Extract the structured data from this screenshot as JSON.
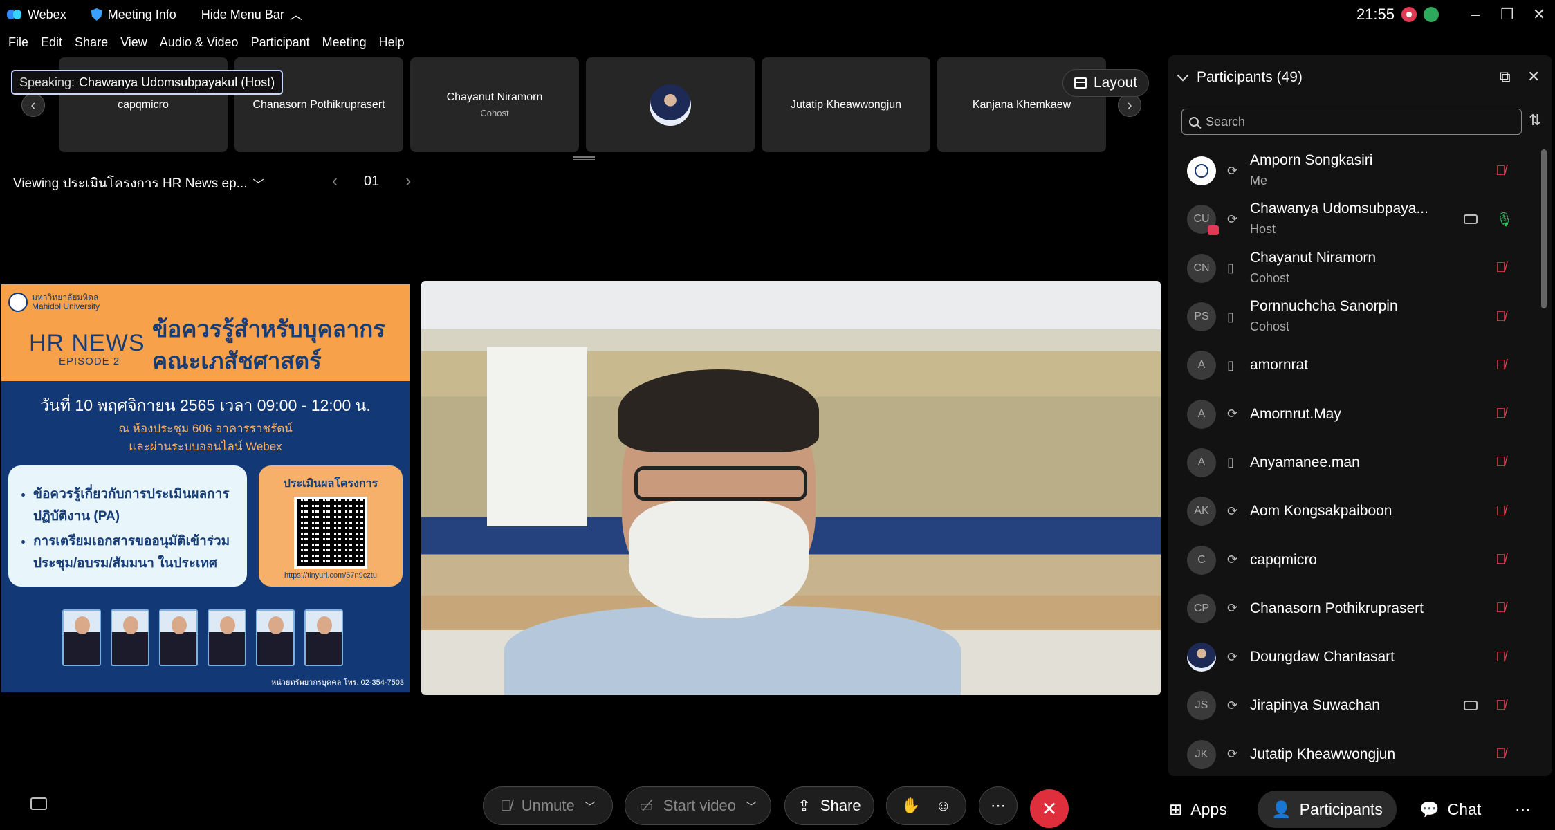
{
  "titlebar": {
    "app_name": "Webex",
    "meeting_info": "Meeting Info",
    "hide_menu": "Hide Menu Bar",
    "clock": "21:55"
  },
  "menu": [
    "File",
    "Edit",
    "Share",
    "View",
    "Audio & Video",
    "Participant",
    "Meeting",
    "Help"
  ],
  "speaking": {
    "label": "Speaking:",
    "name": "Chawanya Udomsubpayakul (Host)"
  },
  "strip": {
    "tiles": [
      {
        "name": "capqmicro",
        "sub": ""
      },
      {
        "name": "Chanasorn Pothikruprasert",
        "sub": ""
      },
      {
        "name": "Chayanut Niramorn",
        "sub": "Cohost"
      },
      {
        "name": "",
        "sub": ""
      },
      {
        "name": "Jutatip Kheawwongjun",
        "sub": ""
      },
      {
        "name": "Kanjana Khemkaew",
        "sub": ""
      }
    ],
    "layout_label": "Layout"
  },
  "viewing": {
    "text": "Viewing ประเมินโครงการ HR News ep...",
    "page": "01"
  },
  "poster": {
    "university_th": "มหาวิทยาลัยมหิดล",
    "university_en": "Mahidol University",
    "hr_news": "HR NEWS",
    "episode": "EPISODE 2",
    "title_line1": "ข้อควรรู้สำหรับบุคลากร",
    "title_line2": "คณะเภสัชศาสตร์",
    "date": "วันที่ 10 พฤศจิกายน 2565 เวลา 09:00 - 12:00 น.",
    "place_line1": "ณ ห้องประชุม 606 อาคารราชรัตน์",
    "place_line2": "และผ่านระบบออนไลน์ Webex",
    "topic1": "ข้อควรรู้เกี่ยวกับการประเมินผลการปฏิบัติงาน (PA)",
    "topic2": "การเตรียมเอกสารขออนุมัติเข้าร่วมประชุม/อบรม/สัมมนา ในประเทศ",
    "eval_title": "ประเมินผลโครงการ",
    "url": "https://tinyurl.com/57n9cztu",
    "footer": "หน่วยทรัพยากรบุคคล โทร. 02-354-7503"
  },
  "panel": {
    "title": "Participants (49)",
    "search_placeholder": "Search",
    "participants": [
      {
        "initials": "",
        "avatar": "logo",
        "name": "Amporn Songkasiri",
        "role": "Me",
        "device": "headset-icon",
        "video": false,
        "mic": "muted"
      },
      {
        "initials": "CU",
        "avatar": "initials-share",
        "name": "Chawanya Udomsubpaya...",
        "role": "Host",
        "device": "headset-icon",
        "video": true,
        "mic": "on"
      },
      {
        "initials": "CN",
        "avatar": "initials",
        "name": "Chayanut Niramorn",
        "role": "Cohost",
        "device": "mobile-icon",
        "video": false,
        "mic": "muted"
      },
      {
        "initials": "PS",
        "avatar": "initials",
        "name": "Pornnuchcha Sanorpin",
        "role": "Cohost",
        "device": "mobile-icon",
        "video": false,
        "mic": "muted"
      },
      {
        "initials": "A",
        "avatar": "initials",
        "name": "amornrat",
        "role": "",
        "device": "mobile-icon",
        "video": false,
        "mic": "muted"
      },
      {
        "initials": "A",
        "avatar": "initials",
        "name": "Amornrut.May",
        "role": "",
        "device": "headset-icon",
        "video": false,
        "mic": "muted"
      },
      {
        "initials": "A",
        "avatar": "initials",
        "name": "Anyamanee.man",
        "role": "",
        "device": "mobile-icon",
        "video": false,
        "mic": "muted"
      },
      {
        "initials": "AK",
        "avatar": "initials",
        "name": "Aom Kongsakpaiboon",
        "role": "",
        "device": "headset-icon",
        "video": false,
        "mic": "muted"
      },
      {
        "initials": "C",
        "avatar": "initials",
        "name": "capqmicro",
        "role": "",
        "device": "headset-icon",
        "video": false,
        "mic": "muted"
      },
      {
        "initials": "CP",
        "avatar": "initials",
        "name": "Chanasorn Pothikruprasert",
        "role": "",
        "device": "headset-icon",
        "video": false,
        "mic": "muted"
      },
      {
        "initials": "",
        "avatar": "photo",
        "name": "Doungdaw Chantasart",
        "role": "",
        "device": "headset-icon",
        "video": false,
        "mic": "muted"
      },
      {
        "initials": "JS",
        "avatar": "initials",
        "name": "Jirapinya Suwachan",
        "role": "",
        "device": "headset-icon",
        "video": true,
        "mic": "muted"
      },
      {
        "initials": "JK",
        "avatar": "initials",
        "name": "Jutatip Kheawwongjun",
        "role": "",
        "device": "headset-icon",
        "video": false,
        "mic": "muted"
      }
    ]
  },
  "bottom": {
    "unmute": "Unmute",
    "start_video": "Start video",
    "share": "Share",
    "apps": "Apps",
    "participants": "Participants",
    "chat": "Chat"
  },
  "colors": {
    "leave": "#e02f3c",
    "muted_mic": "#e0414f",
    "active_mic": "#2fbf62",
    "poster_orange": "#f7a24a",
    "poster_blue": "#123876"
  }
}
